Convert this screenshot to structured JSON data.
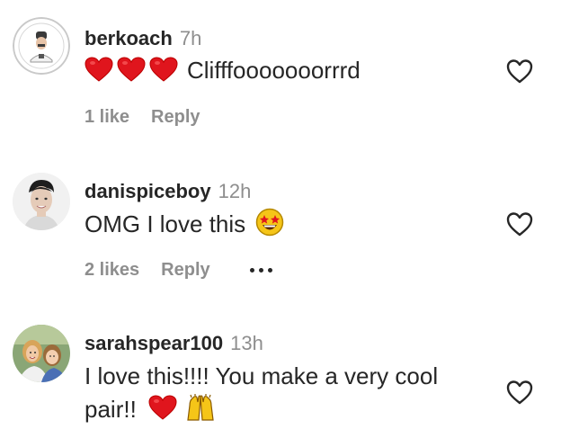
{
  "comments": [
    {
      "username": "berkoach",
      "time": "7h",
      "text": "Clifffooooooorrrd",
      "likes": "1 like",
      "reply": "Reply"
    },
    {
      "username": "danispiceboy",
      "time": "12h",
      "text": "OMG I love this",
      "likes": "2 likes",
      "reply": "Reply"
    },
    {
      "username": "sarahspear100",
      "time": "13h",
      "text_line1": "I love this!!!! You make a very cool",
      "text_line2": "pair!!"
    }
  ],
  "colors": {
    "text": "#262626",
    "muted": "#8e8e8e",
    "heart_red": "#ed1c24"
  },
  "icons": {
    "like": "heart-outline-icon",
    "red_heart": "red-heart-emoji",
    "star_eyes": "star-struck-emoji",
    "raised_hands": "raised-hands-emoji",
    "more": "more-options-icon"
  }
}
